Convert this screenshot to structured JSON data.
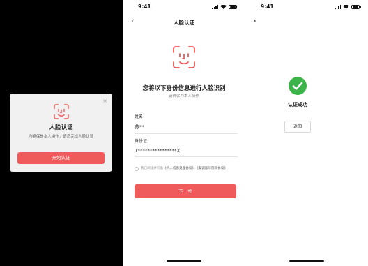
{
  "colors": {
    "accent": "#ef5b5b",
    "success": "#3cb44a"
  },
  "dialog": {
    "icon": "face-scan-icon",
    "close_label": "×",
    "title": "人脸认证",
    "subtitle": "为确保是本人操作，请您完成人脸认证",
    "button": "开始认证"
  },
  "status": {
    "time": "9:41"
  },
  "verify": {
    "nav_title": "人脸认证",
    "heading": "您将以下身份信息进行人脸识别",
    "hint": "请确保为本人操作",
    "fields": [
      {
        "label": "姓名",
        "value": "苏**"
      },
      {
        "label": "身份证",
        "value": "1****************X"
      }
    ],
    "agreement": {
      "prefix": "我已阅读并同意",
      "link1": "《个人信息处理协议》",
      "sep": "、",
      "link2": "《泰诚账号隐私协议》"
    },
    "next_button": "下一步"
  },
  "result": {
    "text": "认证成功",
    "back_button": "返回"
  }
}
